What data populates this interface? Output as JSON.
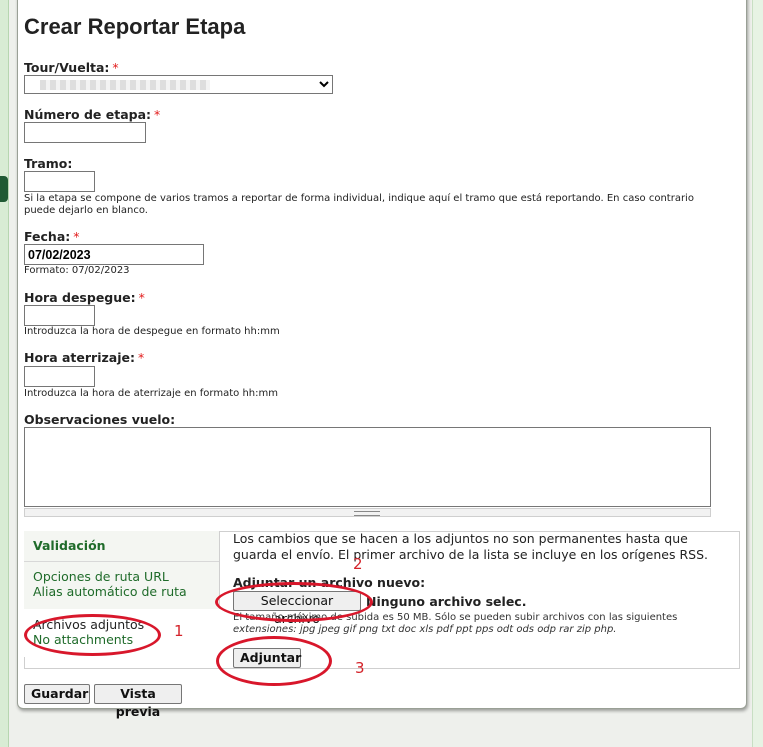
{
  "page": {
    "title": "Crear Reportar Etapa"
  },
  "form": {
    "tour": {
      "label": "Tour/Vuelta:",
      "required": "*"
    },
    "stage": {
      "label": "Número de etapa:",
      "required": "*"
    },
    "section": {
      "label": "Tramo:",
      "description": "Si la etapa se compone de varios tramos a reportar de forma individual, indique aquí el tramo que está reportando. En caso contrario puede dejarlo en blanco."
    },
    "date": {
      "label": "Fecha:",
      "required": "*",
      "value": "07/02/2023",
      "format": "Formato: 07/02/2023"
    },
    "takeoff": {
      "label": "Hora despegue:",
      "required": "*",
      "description": "Introduzca la hora de despegue en formato hh:mm"
    },
    "landing": {
      "label": "Hora aterrizaje:",
      "required": "*",
      "description": "Introduzca la hora de aterrizaje en formato hh:mm"
    },
    "notes": {
      "label": "Observaciones vuelo:"
    }
  },
  "tabs": {
    "validation": "Validación",
    "url_options_title": "Opciones de ruta URL",
    "url_options_sub": "Alias automático de ruta",
    "attachments_title": "Archivos adjuntos",
    "attachments_sub": "No attachments"
  },
  "attachments": {
    "notice": "Los cambios que se hacen a los adjuntos no son permanentes hasta que guarda el envío. El primer archivo de la lista se incluye en los orígenes RSS.",
    "new_label": "Adjuntar un archivo nuevo:",
    "choose_button": "Seleccionar archivo",
    "no_file": "Ninguno archivo selec.",
    "help_line1": "El tamaño máximo de subida es 50 MB. Sólo se pueden subir archivos con las siguientes",
    "help_line2": "extensiones: jpg jpeg gif png txt doc xls pdf ppt pps odt ods odp rar zip php.",
    "attach_button": "Adjuntar"
  },
  "actions": {
    "save": "Guardar",
    "preview": "Vista previa"
  },
  "annotations": {
    "n1": "1",
    "n2": "2",
    "n3": "3",
    "color": "#d8172b"
  }
}
